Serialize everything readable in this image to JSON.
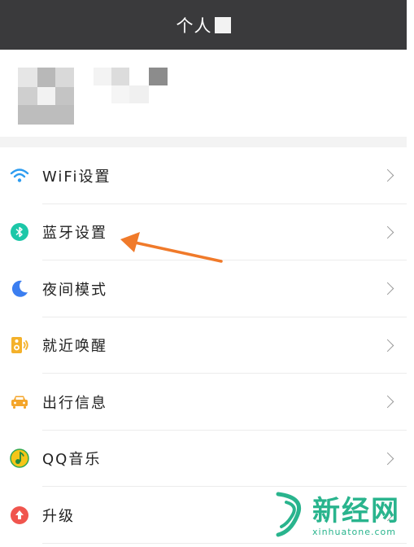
{
  "header": {
    "title": "个人"
  },
  "menu": {
    "items": [
      {
        "label": "WiFi设置",
        "icon": "wifi-icon",
        "color": "#2d9cf0"
      },
      {
        "label": "蓝牙设置",
        "icon": "bluetooth-icon",
        "color": "#1cc7a8"
      },
      {
        "label": "夜间模式",
        "icon": "moon-icon",
        "color": "#3b7ef0"
      },
      {
        "label": "就近唤醒",
        "icon": "speaker-icon",
        "color": "#f4b12a"
      },
      {
        "label": "出行信息",
        "icon": "car-icon",
        "color": "#f4a52a"
      },
      {
        "label": "QQ音乐",
        "icon": "qq-music-icon",
        "color": "#f5c518"
      },
      {
        "label": "升级",
        "icon": "upgrade-icon",
        "color": "#f0554e"
      }
    ]
  },
  "annotation": {
    "arrow_color": "#f07a2a"
  },
  "watermark": {
    "main": "新经网",
    "sub": "xinhuatone.com",
    "color": "#29b48d"
  }
}
